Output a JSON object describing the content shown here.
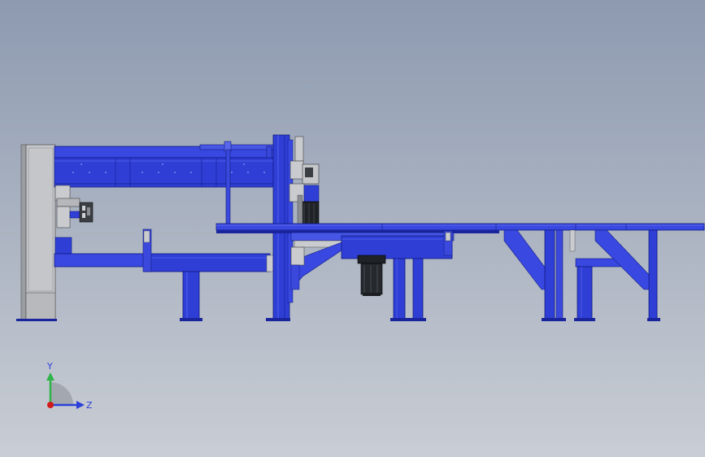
{
  "viewport": {
    "background_top": "#8d9ab0",
    "background_bottom": "#c9cdd4"
  },
  "colors": {
    "steel_blue": "#2f3fd6",
    "steel_blue_light": "#4a5ae8",
    "steel_blue_dark": "#1a249c",
    "guard_gray": "#bfc1c5",
    "gray_dark": "#8a8d92",
    "motor_black": "#1f2226"
  },
  "triad": {
    "y_label": "Y",
    "z_label": "Z",
    "y_color": "#2fb34a",
    "z_color": "#2b3fd8",
    "x_color": "#d11a1a"
  }
}
